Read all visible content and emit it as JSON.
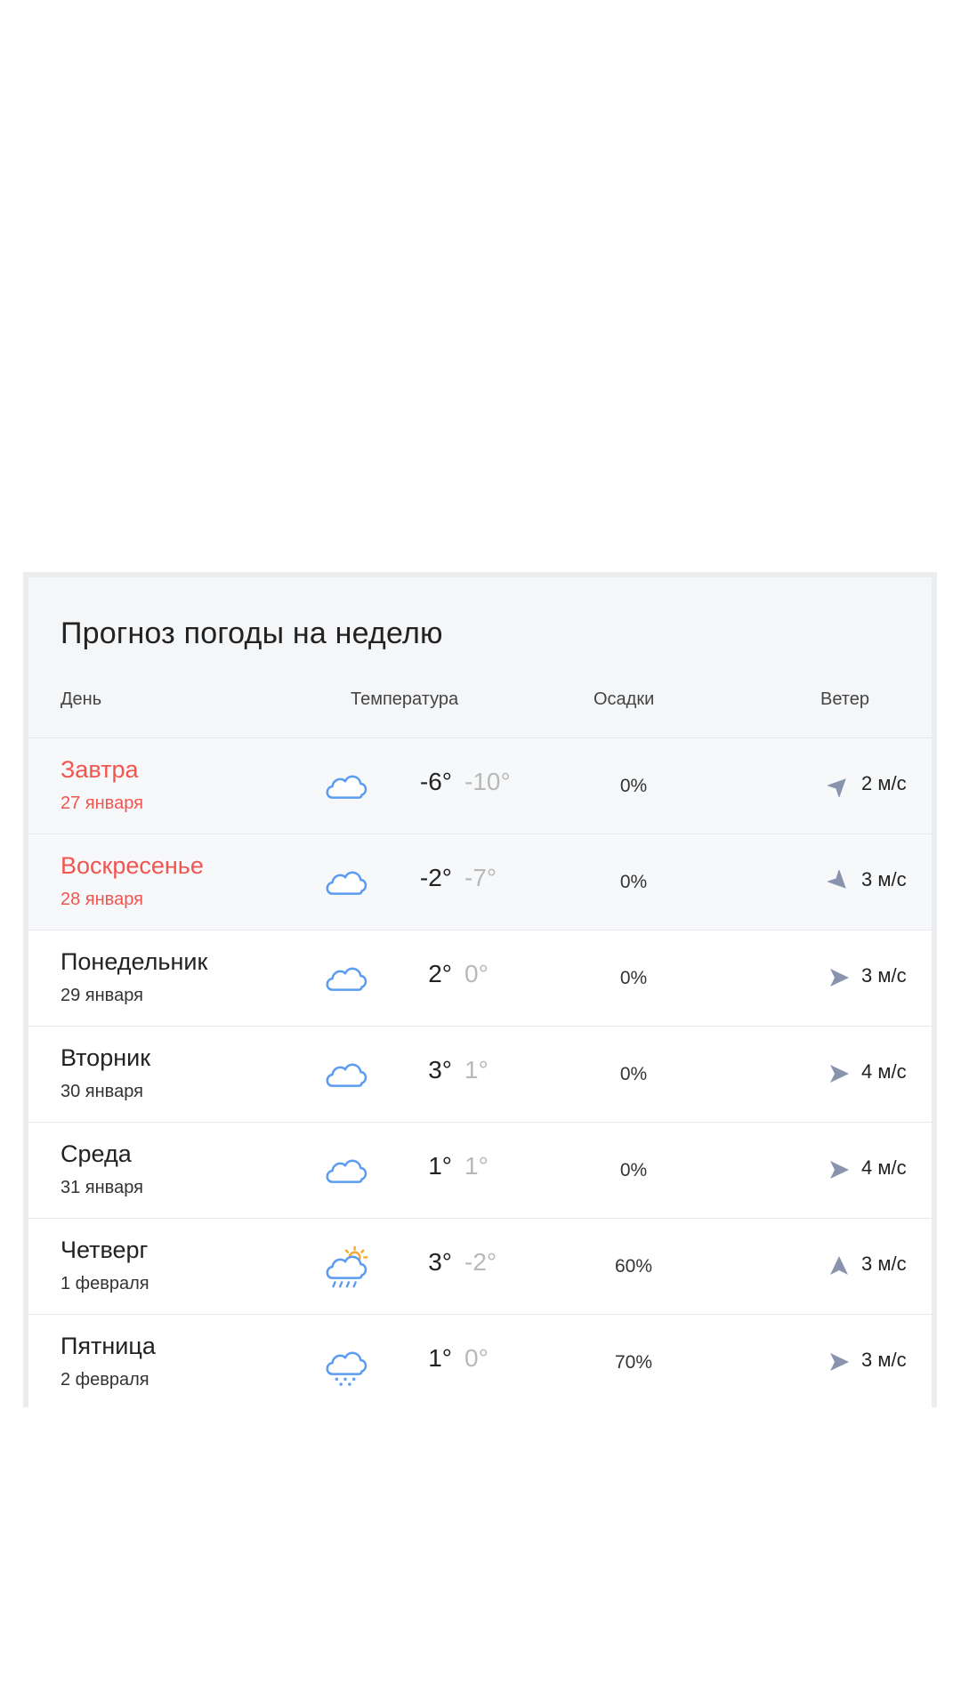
{
  "title": "Прогноз погоды на неделю",
  "headers": {
    "day": "День",
    "temperature": "Температура",
    "precipitation": "Осадки",
    "wind": "Ветер"
  },
  "colors": {
    "weekend": "#f2554f",
    "icon_blue": "#5b9cf2",
    "sun": "#f7a731",
    "arrow": "#8a93ad",
    "min_temp": "#b8b8b8"
  },
  "days": [
    {
      "name": "Завтра",
      "date": "27 января",
      "weekend": true,
      "icon": "cloud-icon",
      "t_max": "-6°",
      "t_min": "-10°",
      "precip": "0%",
      "wind": "2 м/с",
      "wind_dir_deg": 315
    },
    {
      "name": "Воскресенье",
      "date": "28 января",
      "weekend": true,
      "icon": "cloud-icon",
      "t_max": "-2°",
      "t_min": "-7°",
      "precip": "0%",
      "wind": "3 м/с",
      "wind_dir_deg": 45
    },
    {
      "name": "Понедельник",
      "date": "29 января",
      "weekend": false,
      "icon": "cloud-icon",
      "t_max": "2°",
      "t_min": "0°",
      "precip": "0%",
      "wind": "3 м/с",
      "wind_dir_deg": 0
    },
    {
      "name": "Вторник",
      "date": "30 января",
      "weekend": false,
      "icon": "cloud-icon",
      "t_max": "3°",
      "t_min": "1°",
      "precip": "0%",
      "wind": "4 м/с",
      "wind_dir_deg": 0
    },
    {
      "name": "Среда",
      "date": "31 января",
      "weekend": false,
      "icon": "cloud-icon",
      "t_max": "1°",
      "t_min": "1°",
      "precip": "0%",
      "wind": "4 м/с",
      "wind_dir_deg": 0
    },
    {
      "name": "Четверг",
      "date": "1 февраля",
      "weekend": false,
      "icon": "sun-cloud-rain-icon",
      "t_max": "3°",
      "t_min": "-2°",
      "precip": "60%",
      "wind": "3 м/с",
      "wind_dir_deg": 270
    },
    {
      "name": "Пятница",
      "date": "2 февраля",
      "weekend": false,
      "icon": "cloud-snow-icon",
      "t_max": "1°",
      "t_min": "0°",
      "precip": "70%",
      "wind": "3 м/с",
      "wind_dir_deg": 0
    }
  ]
}
